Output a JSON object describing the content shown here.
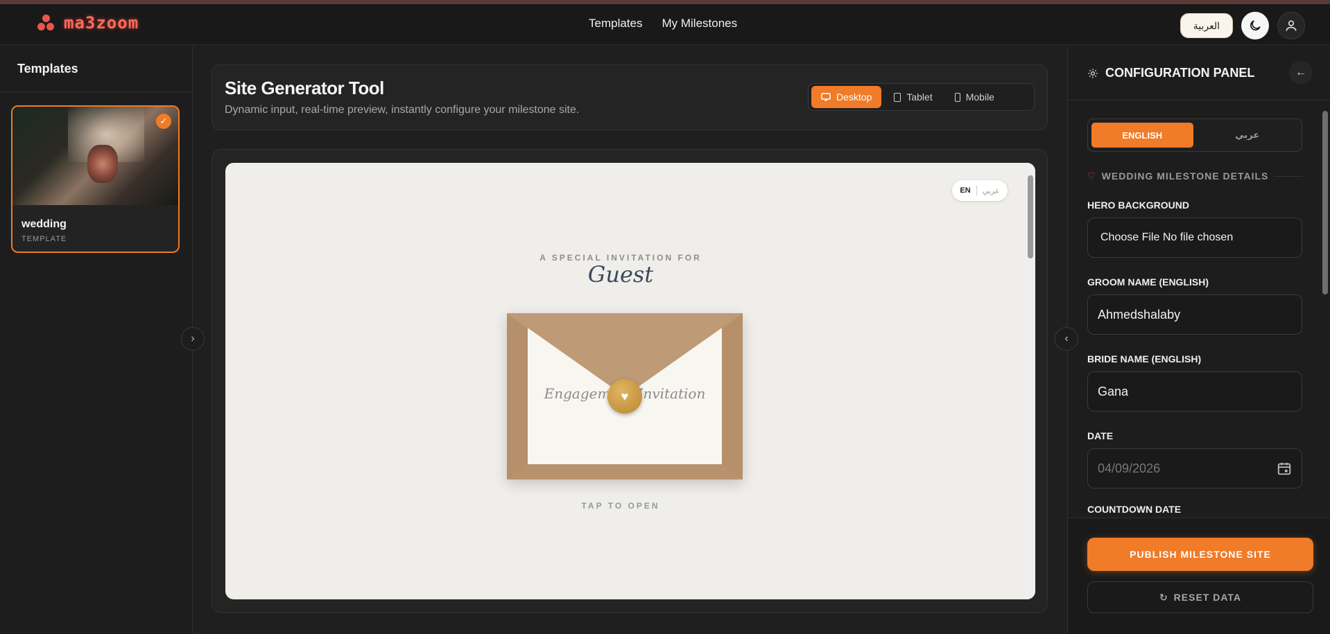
{
  "app": {
    "logo_text": "ma3zoom"
  },
  "nav": {
    "templates": "Templates",
    "milestones": "My Milestones"
  },
  "header": {
    "lang_button": "العربية"
  },
  "sidebar": {
    "title": "Templates",
    "templates": [
      {
        "name": "wedding",
        "type": "TEMPLATE",
        "selected": true
      }
    ]
  },
  "tool": {
    "title": "Site Generator Tool",
    "subtitle": "Dynamic input, real-time preview, instantly configure your milestone site.",
    "devices": [
      {
        "label": "Desktop",
        "icon": "desktop-icon",
        "active": true
      },
      {
        "label": "Tablet",
        "icon": "tablet-icon",
        "active": false
      },
      {
        "label": "Mobile",
        "icon": "mobile-icon",
        "active": false
      }
    ]
  },
  "preview": {
    "lang_en": "EN",
    "lang_ar": "عربي",
    "pre_title": "A SPECIAL INVITATION FOR",
    "guest": "Guest",
    "envelope_text": "Engagement Invitation",
    "tap_to_open": "TAP TO OPEN"
  },
  "config": {
    "title": "CONFIGURATION PANEL",
    "lang_english": "ENGLISH",
    "lang_arabic": "عربي",
    "section": "WEDDING MILESTONE DETAILS",
    "fields": {
      "hero_label": "HERO BACKGROUND",
      "hero_value": "Choose File No file chosen",
      "groom_label": "GROOM NAME (ENGLISH)",
      "groom_value": "Ahmedshalaby",
      "bride_label": "BRIDE NAME (ENGLISH)",
      "bride_value": "Gana",
      "date_label": "DATE",
      "date_value": "04/09/2026",
      "countdown_label": "COUNTDOWN DATE"
    },
    "publish": "PUBLISH MILESTONE SITE",
    "reset": "RESET DATA"
  },
  "colors": {
    "accent": "#f07b28",
    "logo": "#ff6a5c",
    "envelope": "#c29d78",
    "seal": "#c99a45"
  }
}
